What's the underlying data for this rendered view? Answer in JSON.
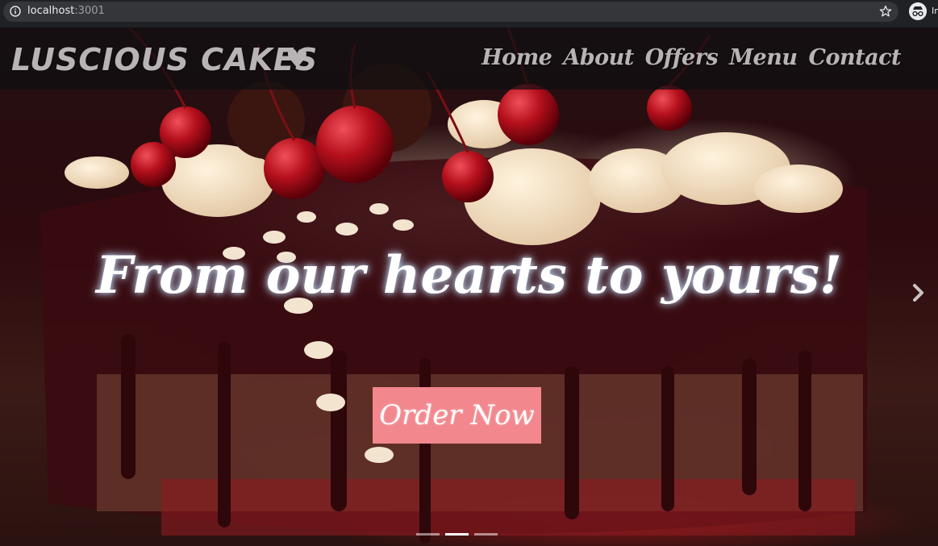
{
  "browser": {
    "url_host": "localhost",
    "url_port": ":3001",
    "profile_label": "In"
  },
  "navbar": {
    "brand": "LUSCIOUS CAKES",
    "brand_heart": "♥",
    "links": [
      {
        "label": "Home"
      },
      {
        "label": "About"
      },
      {
        "label": "Offers"
      },
      {
        "label": "Menu"
      },
      {
        "label": "Contact"
      }
    ]
  },
  "hero": {
    "headline": "From our hearts to yours!",
    "cta_label": "Order Now",
    "slides_count": 3,
    "active_slide": 2
  },
  "colors": {
    "cta_background": "#f2878e",
    "nav_text": "#b8b4b6",
    "browser_chrome": "#202124"
  },
  "icons": {
    "address_info": "info-icon",
    "bookmark": "star-icon",
    "profile": "incognito-icon",
    "carousel_next": "chevron-right-icon"
  }
}
